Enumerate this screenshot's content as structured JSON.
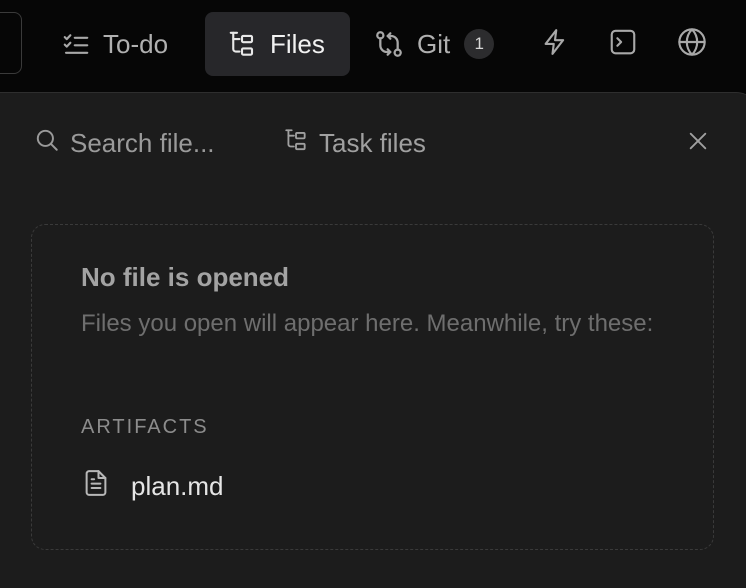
{
  "tabs": {
    "todo": {
      "label": "To-do",
      "icon": "list-checks-icon"
    },
    "files": {
      "label": "Files",
      "icon": "folder-tree-icon",
      "active": true
    },
    "git": {
      "label": "Git",
      "icon": "git-compare-icon",
      "badge": "1"
    }
  },
  "toolbar_icons": [
    "lightning-bolt-icon",
    "terminal-icon",
    "globe-icon"
  ],
  "panel": {
    "search_placeholder": "Search file...",
    "task_files_label": "Task files",
    "close_icon": "close-icon"
  },
  "empty_state": {
    "title": "No file is opened",
    "description": "Files you open will appear here. Meanwhile, try these:",
    "section_label": "ARTIFACTS",
    "files": [
      {
        "name": "plan.md",
        "icon": "file-text-icon"
      }
    ]
  },
  "colors": {
    "background": "#050505",
    "panel": "#1c1c1c",
    "active_tab": "#27272a"
  }
}
